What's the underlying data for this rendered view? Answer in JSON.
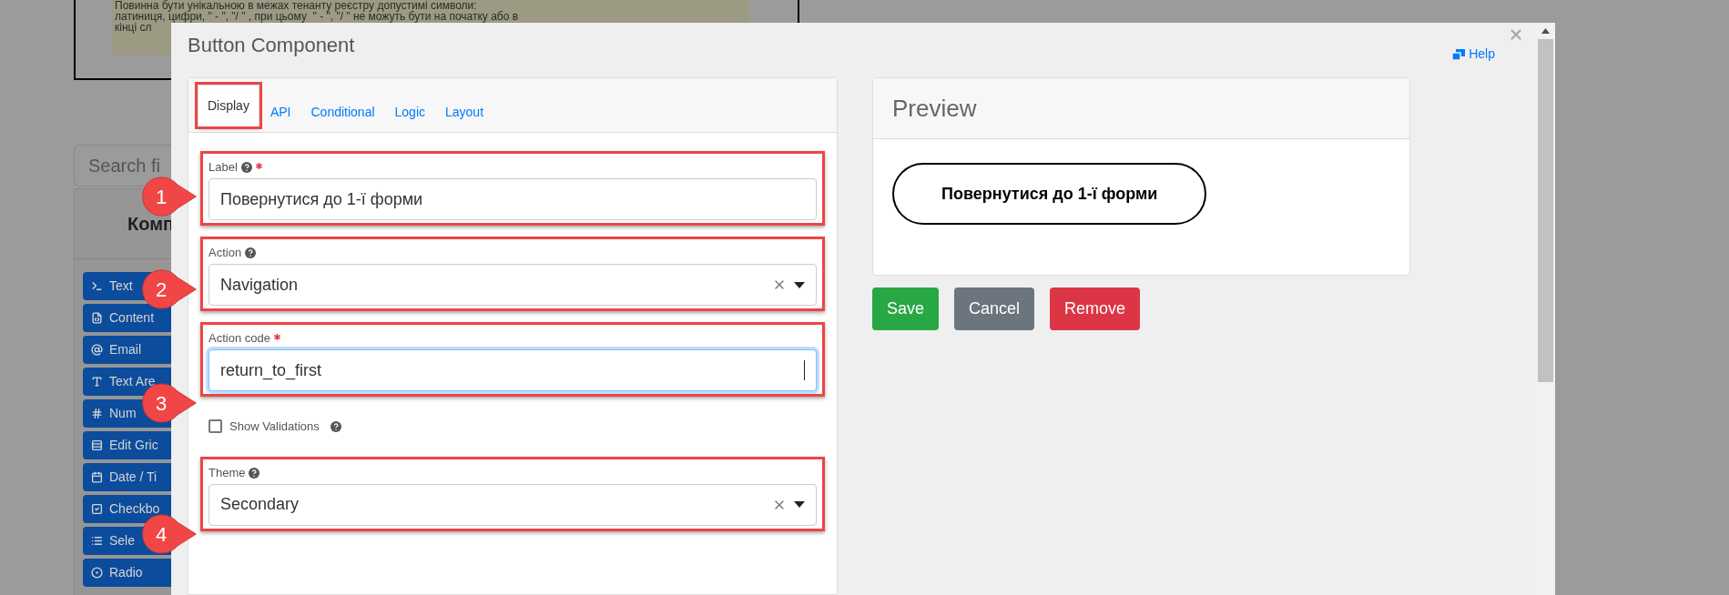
{
  "background_page": {
    "notice_lines": [
      "Повинна бути унікальною в межах тенанту реєстру допустимі символи:",
      "латиниця, цифри, \" - \", \"/ \" , при цьому  \" - \", \"/ \" не можуть бути на початку або в",
      "кінці сл"
    ],
    "search": {
      "placeholder": "Search fi"
    },
    "sidebar": {
      "title": "Комп",
      "items": [
        "Text",
        "Content",
        "Email",
        "Text Are",
        "Num",
        "Edit Gric",
        "Date / Ti",
        "Checkbo",
        "Sele",
        "Radio"
      ]
    }
  },
  "dialog": {
    "title": "Button Component",
    "help": "Help",
    "tabs": [
      {
        "label": "Display",
        "selected": true,
        "highlighted": true
      },
      {
        "label": "API",
        "selected": false,
        "highlighted": false
      },
      {
        "label": "Conditional",
        "selected": false,
        "highlighted": false
      },
      {
        "label": "Logic",
        "selected": false,
        "highlighted": false
      },
      {
        "label": "Layout",
        "selected": false,
        "highlighted": false
      }
    ],
    "fields": [
      {
        "kind": "text",
        "label": "Label",
        "help": true,
        "required": true,
        "value": "Повернутися до 1-ї форми",
        "focused": false,
        "highlighted": true,
        "marker": "1"
      },
      {
        "kind": "select",
        "label": "Action",
        "help": true,
        "required": false,
        "value": "Navigation",
        "focused": false,
        "highlighted": true,
        "marker": "2"
      },
      {
        "kind": "text",
        "label": "Action code",
        "help": false,
        "required": true,
        "value": "return_to_first",
        "focused": true,
        "highlighted": true,
        "marker": "3"
      },
      {
        "kind": "checkbox",
        "label": "Show Validations",
        "help": true,
        "checked": false,
        "highlighted": false
      },
      {
        "kind": "select",
        "label": "Theme",
        "help": true,
        "required": false,
        "value": "Secondary",
        "focused": false,
        "highlighted": true,
        "marker": "4"
      }
    ],
    "preview": {
      "title": "Preview",
      "button_label": "Повернутися до 1-ї форми"
    },
    "buttons": [
      {
        "label": "Save",
        "kind": "success"
      },
      {
        "label": "Cancel",
        "kind": "secondary"
      },
      {
        "label": "Remove",
        "kind": "danger"
      }
    ]
  }
}
